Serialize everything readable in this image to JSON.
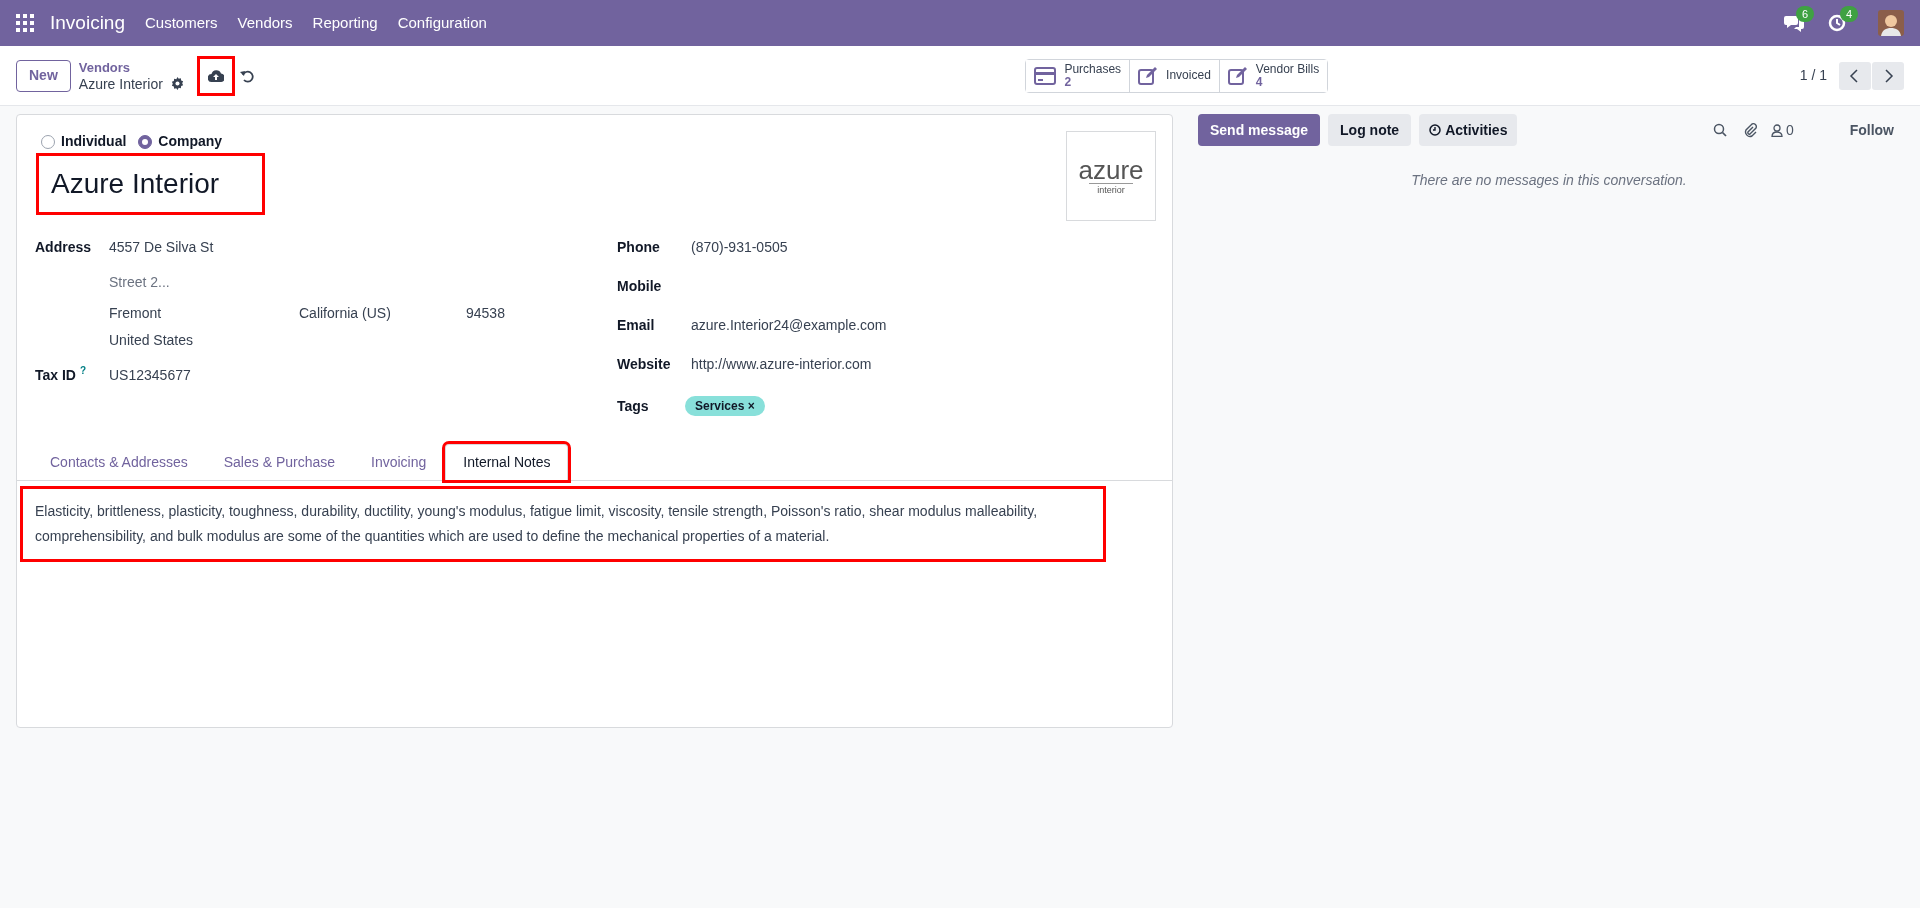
{
  "navbar": {
    "app": "Invoicing",
    "menus": [
      "Customers",
      "Vendors",
      "Reporting",
      "Configuration"
    ],
    "messages_count": "6",
    "activities_count": "4"
  },
  "control_panel": {
    "new_button": "New",
    "breadcrumb_parent": "Vendors",
    "breadcrumb_current": "Azure Interior",
    "save_highlighted": true,
    "stat_buttons": [
      {
        "kind": "card",
        "label": "Purchases",
        "value": "2"
      },
      {
        "kind": "pencil",
        "label": "Invoiced"
      },
      {
        "kind": "pencil",
        "label": "Vendor Bills",
        "value": "4"
      }
    ],
    "pager": "1 / 1"
  },
  "form": {
    "company_types": [
      {
        "label": "Individual",
        "selected": false
      },
      {
        "label": "Company",
        "selected": true
      }
    ],
    "name": "Azure Interior",
    "name_highlighted": true,
    "logo": {
      "word": "azure",
      "sub": "interior"
    },
    "left_fields": [
      {
        "label": "Address",
        "lines": [
          [
            "4557 De Silva St"
          ]
        ],
        "placeholder_line": "Street 2...",
        "city_line": [
          "Fremont",
          "California (US)",
          "94538"
        ],
        "country": "United States"
      }
    ],
    "tax_id": {
      "label": "Tax ID",
      "help": "?",
      "value": "US12345677"
    },
    "right_fields": [
      {
        "label": "Phone",
        "value": "(870)-931-0505"
      },
      {
        "label": "Mobile"
      },
      {
        "label": "Email",
        "value": "azure.Interior24@example.com"
      },
      {
        "label": "Website",
        "value": "http://www.azure-interior.com"
      }
    ],
    "tags": {
      "label": "Tags",
      "items": [
        {
          "text": "Services",
          "remove": "×",
          "color": "#88e0da"
        }
      ]
    },
    "tabs": [
      {
        "label": "Contacts & Addresses",
        "selected": false,
        "highlighted": false
      },
      {
        "label": "Sales & Purchase",
        "selected": false,
        "highlighted": false
      },
      {
        "label": "Invoicing",
        "selected": false,
        "highlighted": false
      },
      {
        "label": "Internal Notes",
        "selected": true,
        "highlighted": true
      }
    ],
    "notes": "Elasticity, brittleness, plasticity, toughness, durability, ductility, young's modulus, fatigue limit, viscosity, tensile strength, Poisson's ratio, shear modulus malleability, comprehensibility, and bulk modulus are some of the quantities which are used to define the mechanical properties of a material.",
    "notes_highlighted": true
  },
  "chatter": {
    "send_message": "Send message",
    "log_note": "Log note",
    "activities": "Activities",
    "followers_count": "0",
    "follow": "Follow",
    "empty": "There are no messages in this conversation."
  }
}
